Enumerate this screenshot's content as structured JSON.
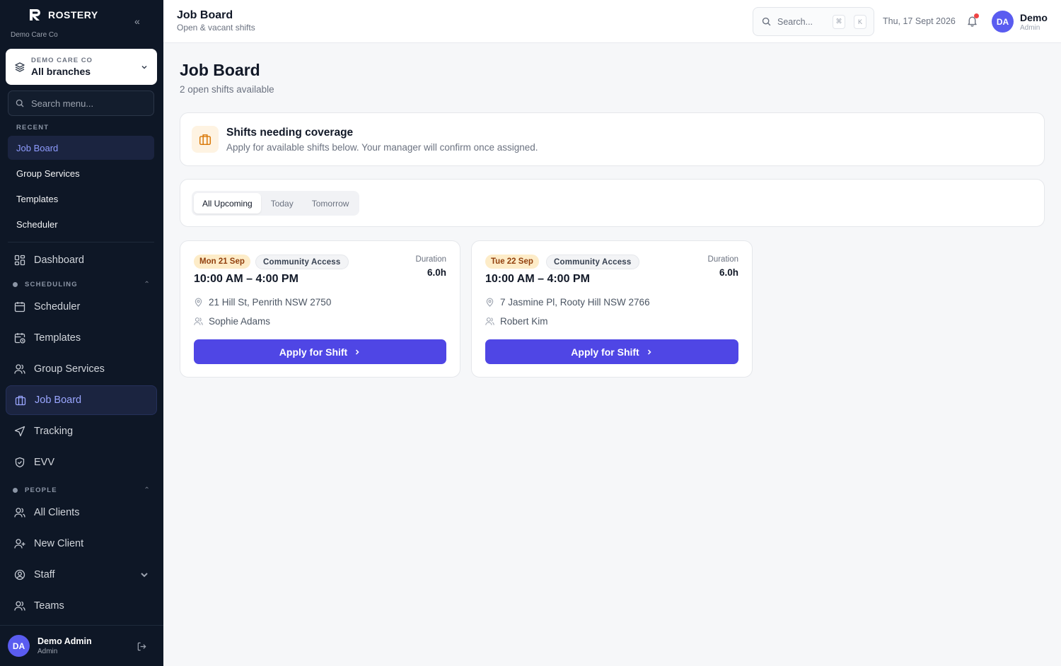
{
  "sidebar": {
    "brand": "ROSTERY",
    "org": "Demo Care Co",
    "branch": {
      "overline": "DEMO CARE CO",
      "label": "All branches"
    },
    "search_placeholder": "Search menu...",
    "recent_label": "RECENT",
    "recent": [
      "Job Board",
      "Group Services",
      "Templates",
      "Scheduler"
    ],
    "nav": {
      "dashboard": "Dashboard",
      "scheduling_label": "SCHEDULING",
      "scheduling": [
        "Scheduler",
        "Templates",
        "Group Services",
        "Job Board",
        "Tracking",
        "EVV"
      ],
      "people_label": "PEOPLE",
      "people": [
        "All Clients",
        "New Client",
        "Staff",
        "Teams"
      ]
    },
    "user": {
      "initials": "DA",
      "name": "Demo Admin",
      "role": "Admin"
    }
  },
  "topbar": {
    "title": "Job Board",
    "subtitle": "Open & vacant shifts",
    "search_placeholder": "Search...",
    "kbd": [
      "⌘",
      "K"
    ],
    "date": "Thu, 17 Sept 2026",
    "user": {
      "initials": "DA",
      "name": "Demo",
      "role": "Admin"
    }
  },
  "main": {
    "title": "Job Board",
    "subtitle": "2 open shifts available",
    "info": {
      "title": "Shifts needing coverage",
      "text": "Apply for available shifts below. Your manager will confirm once assigned."
    },
    "tabs": [
      "All Upcoming",
      "Today",
      "Tomorrow"
    ],
    "active_tab": "All Upcoming",
    "duration_label": "Duration",
    "apply_label": "Apply for Shift",
    "shifts": [
      {
        "date": "Mon 21 Sep",
        "service": "Community Access",
        "time": "10:00 AM – 4:00 PM",
        "duration": "6.0h",
        "address": "21 Hill St, Penrith NSW 2750",
        "client": "Sophie Adams"
      },
      {
        "date": "Tue 22 Sep",
        "service": "Community Access",
        "time": "10:00 AM – 4:00 PM",
        "duration": "6.0h",
        "address": "7 Jasmine Pl, Rooty Hill NSW 2766",
        "client": "Robert Kim"
      }
    ]
  },
  "colors": {
    "sidebar_bg": "#0e1726",
    "accent": "#4f46e5",
    "active_nav": "#9aa6ff",
    "date_badge": "#fdecc8",
    "notification": "#ef4444"
  }
}
